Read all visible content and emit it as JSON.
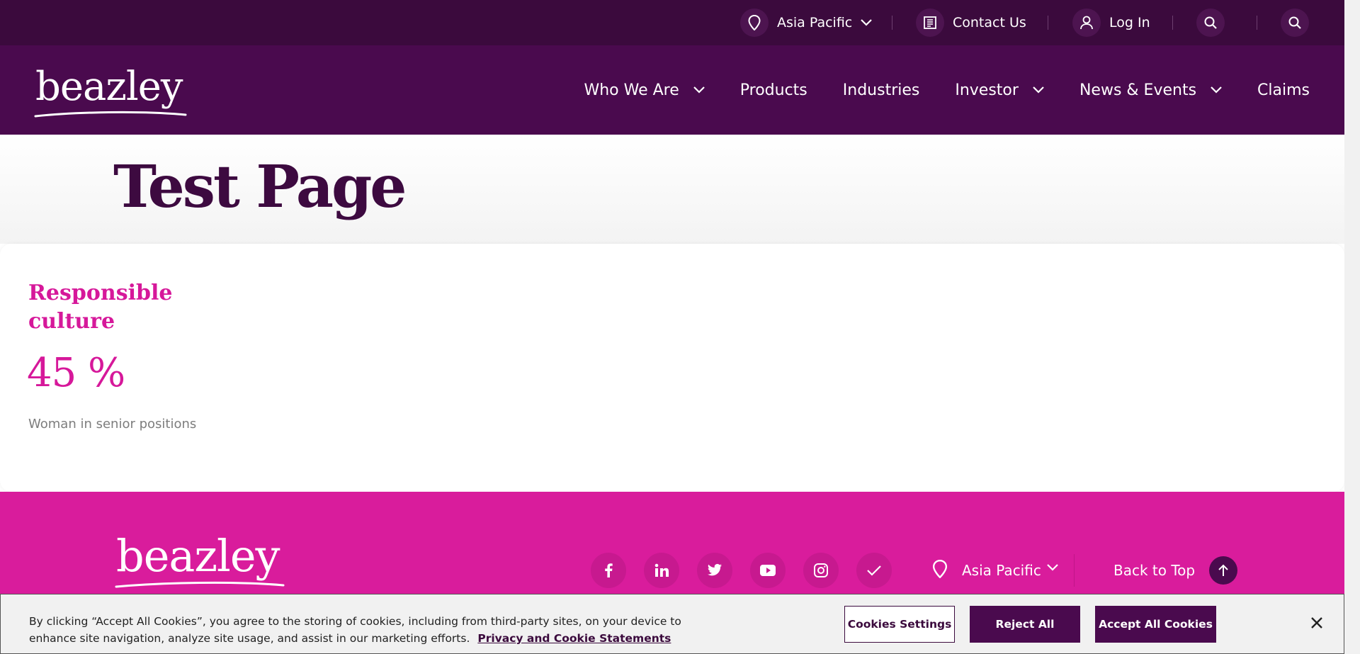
{
  "topbar": {
    "region_label": "Asia Pacific",
    "contact_label": "Contact Us",
    "login_label": "Log In"
  },
  "brand": {
    "logo_text": "beazley"
  },
  "nav": {
    "items": [
      {
        "label": "Who We Are",
        "has_dropdown": true
      },
      {
        "label": "Products",
        "has_dropdown": false
      },
      {
        "label": "Industries",
        "has_dropdown": false
      },
      {
        "label": "Investor",
        "has_dropdown": true
      },
      {
        "label": "News & Events",
        "has_dropdown": true
      },
      {
        "label": "Claims",
        "has_dropdown": false
      }
    ]
  },
  "hero": {
    "title": "Test Page"
  },
  "stat": {
    "title": "Responsible culture",
    "value": "45 %",
    "description": "Woman in senior positions"
  },
  "footer": {
    "logo_text": "beazley",
    "social_icons": [
      "facebook-icon",
      "linkedin-icon",
      "twitter-icon",
      "youtube-icon",
      "instagram-icon",
      "checkmark-icon"
    ],
    "region_label": "Asia Pacific",
    "back_to_top_label": "Back to Top"
  },
  "cookie": {
    "text": "By clicking “Accept All Cookies”, you agree to the storing of cookies, including from third-party sites, on your device to enhance site navigation, analyze site usage, and assist in our marketing efforts.",
    "link_label": "Privacy and Cookie Statements",
    "settings_label": "Cookies Settings",
    "reject_label": "Reject All",
    "accept_label": "Accept All Cookies"
  },
  "colors": {
    "topbar": "#3b0a3d",
    "nav": "#4a0a4e",
    "accent_pink": "#d6189a",
    "footer": "#d91c9c",
    "title": "#3d0a40"
  }
}
